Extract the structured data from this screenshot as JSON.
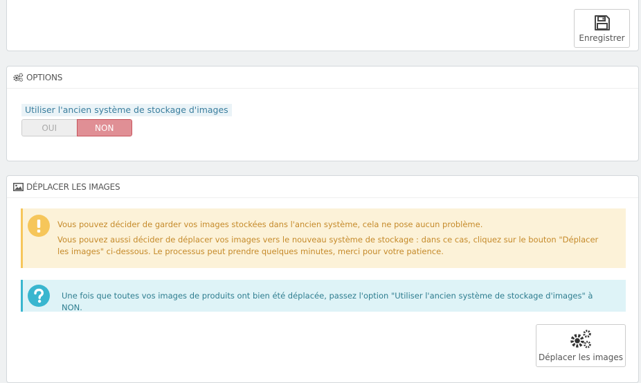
{
  "toolbar": {
    "save_label": "Enregistrer"
  },
  "options_panel": {
    "title": "OPTIONS",
    "field_label": "Utiliser l'ancien système de stockage d'images",
    "switch_yes": "OUI",
    "switch_no": "NON",
    "selected": "NON"
  },
  "move_panel": {
    "title": "DÉPLACER LES IMAGES",
    "warning_line1": "Vous pouvez décider de garder vos images stockées dans l'ancien système, cela ne pose aucun problème.",
    "warning_line2": "Vous pouvez aussi décider de déplacer vos images vers le nouveau système de stockage : dans ce cas, cliquez sur le bouton \"Déplacer les images\" ci-dessous. Le processus peut prendre quelques minutes, merci pour votre patience.",
    "info_text": "Une fois que toutes vos images de produits ont bien été déplacée, passez l'option \"Utiliser l'ancien système de stockage d'images\" à NON.",
    "move_button_label": "Déplacer les images"
  },
  "colors": {
    "switch_on": "#e08f95",
    "warning_bg": "#fcf2d8",
    "warning_accent": "#f6c65a",
    "info_bg": "#def3f7",
    "info_accent": "#39b6cf"
  },
  "icons": {
    "save": "floppy-disk-icon",
    "options": "cogs-icon",
    "move_panel": "image-icon",
    "warning": "exclamation-circle-icon",
    "info": "question-circle-icon",
    "move_button": "cogs-icon"
  }
}
